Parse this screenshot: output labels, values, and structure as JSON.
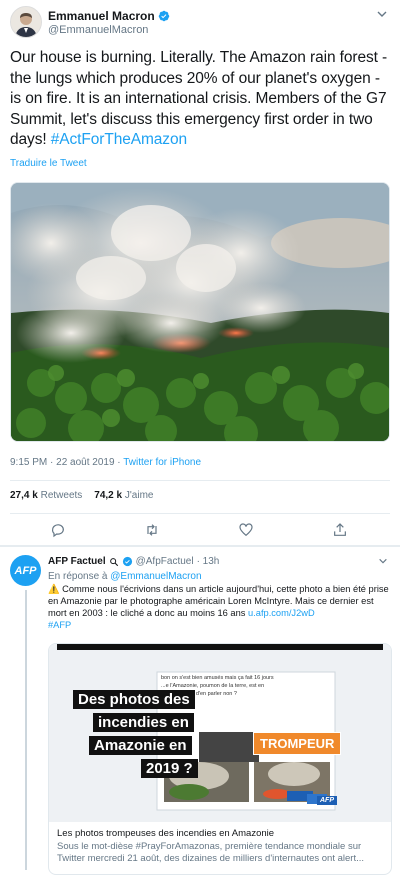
{
  "tweet": {
    "author_name": "Emmanuel Macron",
    "author_handle": "@EmmanuelMacron",
    "text_main": "Our house is burning. Literally. The Amazon rain forest - the lungs which produces 20% of our planet's oxygen - is on fire. It is an international crisis. Members of the G7 Summit, let's discuss this emergency first order in two days! ",
    "hashtag": "#ActForTheAmazon",
    "translate_label": "Traduire le Tweet",
    "time_date": "9:15 PM · 22 août 2019 · ",
    "source": "Twitter for iPhone",
    "retweets_count": "27,4 k",
    "retweets_label": "Retweets",
    "likes_count": "74,2 k",
    "likes_label": "J'aime"
  },
  "reply": {
    "author_name": "AFP Factuel",
    "author_handle": "@AfpFactuel",
    "time": "· 13h",
    "avatar_text": "AFP",
    "in_reply_prefix": "En réponse à ",
    "in_reply_handle": "@EmmanuelMacron",
    "text": "⚠️ Comme nous l'écrivions dans un article aujourd'hui, cette photo a bien été prise en Amazonie par le photographe américain Loren McIntyre. Mais ce dernier est mort en 2003 : le cliché a donc au moins 16 ans ",
    "link": "u.afp.com/J2wD",
    "hashtag": "#AFP",
    "card": {
      "overlay_lines": [
        "Des photos des",
        "incendies en",
        "Amazonie en",
        "2019 ?"
      ],
      "badge": "TROMPEUR",
      "logo": "AFP",
      "article_lines": [
        "bon on s'est bien amusés mais ça fait 16 jours",
        "...e l'Amazonie, poumon de la terre, est en",
        "...érale temps d'en parler non ?",
        "...nia"
      ],
      "title": "Les photos trompeuses des incendies en Amazonie",
      "description": "Sous le mot-dièse #PrayForAmazonas, première tendance mondiale sur Twitter mercredi 21 août, des dizaines de milliers d'internautes ont alert..."
    }
  },
  "colors": {
    "accent": "#1da1f2",
    "muted": "#657786",
    "text": "#14171a",
    "badge_orange": "#f0892b"
  },
  "icons": [
    "verified-badge-icon",
    "chevron-down-icon",
    "reply-icon",
    "retweet-icon",
    "like-icon",
    "share-icon",
    "search-icon"
  ]
}
